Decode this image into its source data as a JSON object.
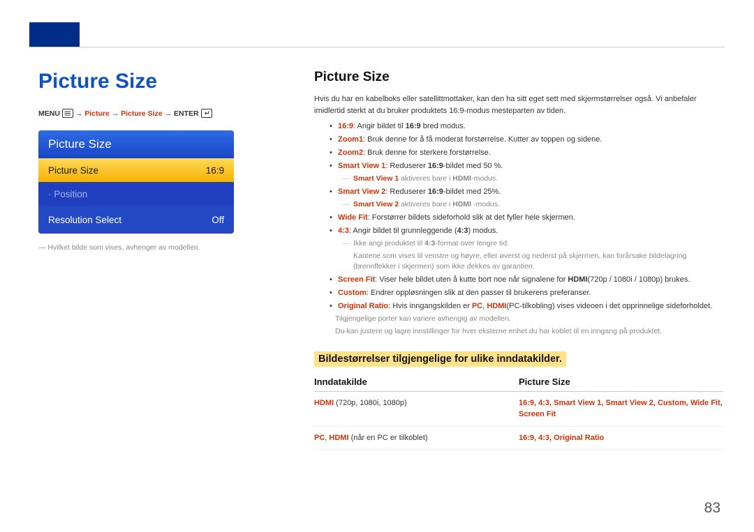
{
  "page_number": 83,
  "left": {
    "title": "Picture Size",
    "breadcrumb": {
      "menu": "MENU",
      "path1": "Picture",
      "path2": "Picture Size",
      "enter": "ENTER"
    },
    "panel": {
      "title": "Picture Size",
      "rows": [
        {
          "label": "Picture Size",
          "value": "16:9"
        },
        {
          "label": "· Position",
          "value": ""
        },
        {
          "label": "Resolution Select",
          "value": "Off"
        }
      ]
    },
    "caption_dash": "―",
    "caption": "Hvilket bilde som vises, avhenger av modellen."
  },
  "right": {
    "title": "Picture Size",
    "intro": "Hvis du har en kabelboks eller satellittmottaker, kan den ha sitt eget sett med skjermstørrelser også. Vi anbefaler imidlertid sterkt at du bruker produktets 16:9-modus mesteparten av tiden.",
    "b_169": "16:9",
    "b_169_txt": ": Angir bildet til ",
    "b_169_suf": " bred modus.",
    "zoom1": "Zoom1",
    "zoom1_txt": ": Bruk denne for å få moderat forstørrelse. Kutter av toppen og sidene.",
    "zoom2": "Zoom2",
    "zoom2_txt": ": Bruk denne for sterkere forstørrelse.",
    "sv1": "Smart View 1",
    "sv1_txt": ": Reduserer ",
    "sv1_b": "16:9",
    "sv1_suf": "-bildet med 50 %.",
    "sv1_note_a": "Smart View 1",
    "sv1_note_mid": " aktiveres bare i ",
    "sv1_note_b": "HDMI",
    "sv1_note_suf": "-modus.",
    "sv2": "Smart View 2",
    "sv2_txt": ": Reduserer ",
    "sv2_b": "16:9",
    "sv2_suf": "-bildet med 25%.",
    "sv2_note_a": "Smart View 2",
    "sv2_note_mid": " aktiveres bare i ",
    "sv2_note_b": "HDMI",
    "sv2_note_suf": " -modus.",
    "wf": "Wide Fit",
    "wf_txt": ": Forstørrer bildets sideforhold slik at det fyller hele skjermen.",
    "r43": "4:3",
    "r43_mid": ": Angir bildet til grunnleggende (",
    "r43b": "4:3",
    "r43_suf": ") modus.",
    "r43_note1": "Ikke angi produktet til ",
    "r43_note1b": "4:3",
    "r43_note1_suf": "-format over lengre tid.",
    "r43_note2": "Kantene som vises til venstre og høyre, eller øverst og nederst på skjermen, kan forårsake bildelagring (brennflekker i skjermen) som ikke dekkes av garantien.",
    "sf": "Screen Fit",
    "sf_txt": ": Viser hele bildet uten å kutte bort noe når signalene for ",
    "sf_b": "HDMI",
    "sf_suf": "(720p / 1080i / 1080p) brukes.",
    "custom": "Custom",
    "custom_txt": ": Endrer oppløsningen slik at den passer til brukerens preferanser.",
    "orig": "Original Ratio",
    "orig_txt": ": Hvis inngangskilden er ",
    "orig_b1": "PC",
    "orig_c": ", ",
    "orig_b2": "HDMI",
    "orig_suf": "(PC-tilkobling) vises videoen i det opprinnelige sideforholdet.",
    "foot1": "Tilgjengelige porter kan variere avhengig av modellen.",
    "foot2": "Du kan justere og lagre innstillinger for hver eksterne enhet du har koblet til en inngang på produktet.",
    "subsection": "Bildestørrelser tilgjengelige for ulike inndatakilder.",
    "th1": "Inndatakilde",
    "th2": "Picture Size",
    "r1a": "HDMI",
    "r1a_suf": " (720p, 1080i, 1080p)",
    "r1b": "16:9, 4:3, Smart View 1, Smart View 2, Custom, Wide Fit, Screen Fit",
    "r2a1": "PC",
    "r2ac": ", ",
    "r2a2": "HDMI",
    "r2a_suf": " (når en PC er tilkoblet)",
    "r2b": "16:9, 4:3, Original Ratio"
  }
}
